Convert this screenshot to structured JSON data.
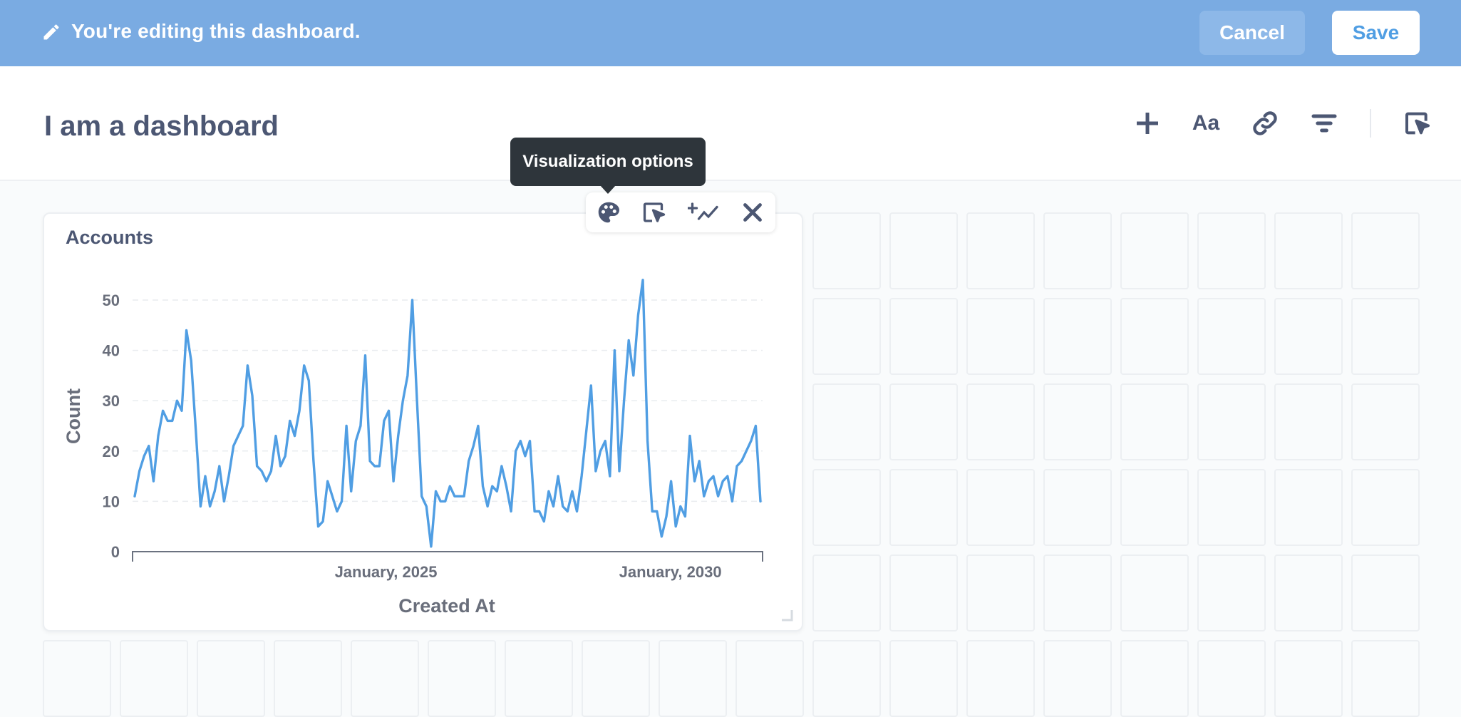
{
  "edit_bar": {
    "message": "You're editing this dashboard.",
    "cancel_label": "Cancel",
    "save_label": "Save"
  },
  "header": {
    "title": "I am a dashboard",
    "tools": [
      {
        "name": "add-question",
        "icon": "plus-icon"
      },
      {
        "name": "add-text",
        "icon": "text-aa-icon",
        "text": "Aa"
      },
      {
        "name": "add-link",
        "icon": "link-icon"
      },
      {
        "name": "add-filter",
        "icon": "filter-icon"
      },
      {
        "name": "click-behavior",
        "icon": "click-cursor-icon"
      }
    ]
  },
  "card": {
    "title": "Accounts",
    "actions": [
      {
        "name": "visualization-options",
        "icon": "palette-icon"
      },
      {
        "name": "click-behavior",
        "icon": "click-cursor-icon"
      },
      {
        "name": "add-series",
        "icon": "add-series-icon"
      },
      {
        "name": "remove-card",
        "icon": "close-icon"
      }
    ],
    "tooltip": "Visualization options"
  },
  "colors": {
    "edit_bar_bg": "#7aabe2",
    "accent": "#509ee3",
    "series": "#509ee3",
    "text": "#4c5773"
  },
  "chart_data": {
    "type": "line",
    "xlabel": "Created At",
    "ylabel": "Count",
    "ylim": [
      0,
      55
    ],
    "yticks": [
      0,
      10,
      20,
      30,
      40,
      50
    ],
    "xticks": [
      {
        "label": "January, 2025",
        "x": "2025-01"
      },
      {
        "label": "January, 2030",
        "x": "2030-01"
      }
    ],
    "x_start": "2020-08",
    "x_end": "2031-08",
    "grid": true,
    "series": [
      {
        "values": [
          11,
          16,
          19,
          21,
          14,
          23,
          28,
          26,
          26,
          30,
          28,
          44,
          38,
          24,
          9,
          15,
          9,
          12,
          17,
          10,
          15,
          21,
          23,
          25,
          37,
          31,
          17,
          16,
          14,
          16,
          23,
          17,
          19,
          26,
          23,
          28,
          37,
          34,
          18,
          5,
          6,
          14,
          11,
          8,
          10,
          25,
          12,
          22,
          25,
          39,
          18,
          17,
          17,
          26,
          28,
          14,
          23,
          30,
          35,
          50,
          30,
          11,
          9,
          1,
          12,
          10,
          10,
          13,
          11,
          11,
          11,
          18,
          21,
          25,
          13,
          9,
          13,
          12,
          17,
          13,
          8,
          20,
          22,
          19,
          22,
          8,
          8,
          6,
          12,
          9,
          15,
          9,
          8,
          12,
          8,
          15,
          24,
          33,
          16,
          20,
          22,
          15,
          40,
          16,
          30,
          42,
          35,
          47,
          54,
          22,
          8,
          8,
          3,
          7,
          14,
          5,
          9,
          7,
          23,
          14,
          18,
          11,
          14,
          15,
          11,
          14,
          15,
          10,
          17,
          18,
          20,
          22,
          25,
          10
        ]
      }
    ]
  }
}
